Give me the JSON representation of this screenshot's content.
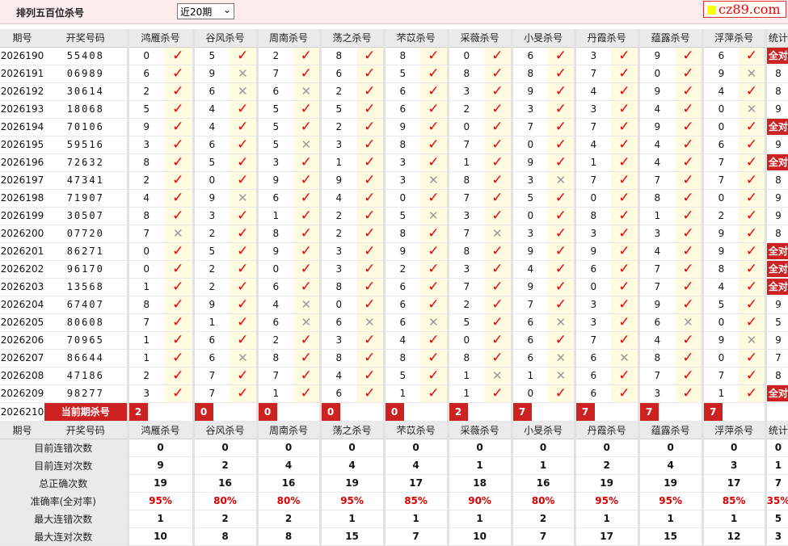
{
  "header": {
    "title": "排列五百位杀号",
    "select_value": "近20期",
    "logo_text": "cz89.com"
  },
  "columns": {
    "period": "期号",
    "numbers": "开奖号码",
    "stat": "统计",
    "groups": [
      "鸿雁杀号",
      "谷风杀号",
      "周南杀号",
      "荡之杀号",
      "芣苡杀号",
      "采薇杀号",
      "小旻杀号",
      "丹霞杀号",
      "蕴露杀号",
      "浮萍杀号"
    ]
  },
  "rows": [
    {
      "p": "2026190",
      "n": "55408",
      "v": [
        "0",
        "5",
        "2",
        "8",
        "8",
        "0",
        "6",
        "3",
        "9",
        "6"
      ],
      "r": [
        "y",
        "y",
        "y",
        "y",
        "y",
        "y",
        "y",
        "y",
        "y",
        "y"
      ],
      "s": "全对"
    },
    {
      "p": "2026191",
      "n": "06989",
      "v": [
        "6",
        "9",
        "7",
        "6",
        "5",
        "8",
        "8",
        "7",
        "0",
        "9"
      ],
      "r": [
        "y",
        "n",
        "y",
        "y",
        "y",
        "y",
        "y",
        "y",
        "y",
        "n"
      ],
      "s": "8"
    },
    {
      "p": "2026192",
      "n": "30614",
      "v": [
        "2",
        "6",
        "6",
        "2",
        "6",
        "3",
        "9",
        "4",
        "9",
        "4"
      ],
      "r": [
        "y",
        "n",
        "n",
        "y",
        "y",
        "y",
        "y",
        "y",
        "y",
        "y"
      ],
      "s": "8"
    },
    {
      "p": "2026193",
      "n": "18068",
      "v": [
        "5",
        "4",
        "5",
        "5",
        "6",
        "2",
        "3",
        "3",
        "4",
        "0"
      ],
      "r": [
        "y",
        "y",
        "y",
        "y",
        "y",
        "y",
        "y",
        "y",
        "y",
        "n"
      ],
      "s": "9"
    },
    {
      "p": "2026194",
      "n": "70106",
      "v": [
        "9",
        "4",
        "5",
        "2",
        "9",
        "0",
        "7",
        "7",
        "9",
        "0"
      ],
      "r": [
        "y",
        "y",
        "y",
        "y",
        "y",
        "y",
        "y",
        "y",
        "y",
        "y"
      ],
      "s": "全对"
    },
    {
      "p": "2026195",
      "n": "59516",
      "v": [
        "3",
        "6",
        "5",
        "3",
        "8",
        "7",
        "0",
        "4",
        "4",
        "6"
      ],
      "r": [
        "y",
        "y",
        "n",
        "y",
        "y",
        "y",
        "y",
        "y",
        "y",
        "y"
      ],
      "s": "9"
    },
    {
      "p": "2026196",
      "n": "72632",
      "v": [
        "8",
        "5",
        "3",
        "1",
        "3",
        "1",
        "9",
        "1",
        "4",
        "7"
      ],
      "r": [
        "y",
        "y",
        "y",
        "y",
        "y",
        "y",
        "y",
        "y",
        "y",
        "y"
      ],
      "s": "全对"
    },
    {
      "p": "2026197",
      "n": "47341",
      "v": [
        "2",
        "0",
        "9",
        "9",
        "3",
        "8",
        "3",
        "7",
        "7",
        "7"
      ],
      "r": [
        "y",
        "y",
        "y",
        "y",
        "n",
        "y",
        "n",
        "y",
        "y",
        "y"
      ],
      "s": "8"
    },
    {
      "p": "2026198",
      "n": "71907",
      "v": [
        "4",
        "9",
        "6",
        "4",
        "0",
        "7",
        "5",
        "0",
        "8",
        "0"
      ],
      "r": [
        "y",
        "n",
        "y",
        "y",
        "y",
        "y",
        "y",
        "y",
        "y",
        "y"
      ],
      "s": "9"
    },
    {
      "p": "2026199",
      "n": "30507",
      "v": [
        "8",
        "3",
        "1",
        "2",
        "5",
        "3",
        "0",
        "8",
        "1",
        "2"
      ],
      "r": [
        "y",
        "y",
        "y",
        "y",
        "n",
        "y",
        "y",
        "y",
        "y",
        "y"
      ],
      "s": "9"
    },
    {
      "p": "2026200",
      "n": "07720",
      "v": [
        "7",
        "2",
        "8",
        "2",
        "8",
        "7",
        "3",
        "3",
        "3",
        "9"
      ],
      "r": [
        "n",
        "y",
        "y",
        "y",
        "y",
        "n",
        "y",
        "y",
        "y",
        "y"
      ],
      "s": "8"
    },
    {
      "p": "2026201",
      "n": "86271",
      "v": [
        "0",
        "5",
        "9",
        "3",
        "9",
        "8",
        "9",
        "9",
        "4",
        "9"
      ],
      "r": [
        "y",
        "y",
        "y",
        "y",
        "y",
        "y",
        "y",
        "y",
        "y",
        "y"
      ],
      "s": "全对"
    },
    {
      "p": "2026202",
      "n": "96170",
      "v": [
        "0",
        "2",
        "0",
        "3",
        "2",
        "3",
        "4",
        "6",
        "7",
        "8"
      ],
      "r": [
        "y",
        "y",
        "y",
        "y",
        "y",
        "y",
        "y",
        "y",
        "y",
        "y"
      ],
      "s": "全对"
    },
    {
      "p": "2026203",
      "n": "13568",
      "v": [
        "1",
        "2",
        "6",
        "8",
        "6",
        "7",
        "9",
        "0",
        "7",
        "4"
      ],
      "r": [
        "y",
        "y",
        "y",
        "y",
        "y",
        "y",
        "y",
        "y",
        "y",
        "y"
      ],
      "s": "全对"
    },
    {
      "p": "2026204",
      "n": "67407",
      "v": [
        "8",
        "9",
        "4",
        "0",
        "6",
        "2",
        "7",
        "3",
        "9",
        "5"
      ],
      "r": [
        "y",
        "y",
        "n",
        "y",
        "y",
        "y",
        "y",
        "y",
        "y",
        "y"
      ],
      "s": "9"
    },
    {
      "p": "2026205",
      "n": "80608",
      "v": [
        "7",
        "1",
        "6",
        "6",
        "6",
        "5",
        "6",
        "3",
        "6",
        "0"
      ],
      "r": [
        "y",
        "y",
        "n",
        "n",
        "n",
        "y",
        "n",
        "y",
        "n",
        "y"
      ],
      "s": "5"
    },
    {
      "p": "2026206",
      "n": "70965",
      "v": [
        "1",
        "6",
        "2",
        "3",
        "4",
        "0",
        "6",
        "7",
        "4",
        "9"
      ],
      "r": [
        "y",
        "y",
        "y",
        "y",
        "y",
        "y",
        "y",
        "y",
        "y",
        "n"
      ],
      "s": "9"
    },
    {
      "p": "2026207",
      "n": "86644",
      "v": [
        "1",
        "6",
        "8",
        "8",
        "8",
        "8",
        "6",
        "6",
        "8",
        "0"
      ],
      "r": [
        "y",
        "n",
        "y",
        "y",
        "y",
        "y",
        "n",
        "n",
        "y",
        "y"
      ],
      "s": "7"
    },
    {
      "p": "2026208",
      "n": "47186",
      "v": [
        "2",
        "7",
        "7",
        "4",
        "5",
        "1",
        "1",
        "6",
        "7",
        "7"
      ],
      "r": [
        "y",
        "y",
        "y",
        "y",
        "y",
        "n",
        "n",
        "y",
        "y",
        "y"
      ],
      "s": "8"
    },
    {
      "p": "2026209",
      "n": "98277",
      "v": [
        "3",
        "7",
        "1",
        "6",
        "1",
        "1",
        "0",
        "6",
        "3",
        "1"
      ],
      "r": [
        "y",
        "y",
        "y",
        "y",
        "y",
        "y",
        "y",
        "y",
        "y",
        "y"
      ],
      "s": "全对"
    }
  ],
  "current": {
    "p": "2026210",
    "label": "当前期杀号",
    "v": [
      "2",
      "0",
      "0",
      "0",
      "0",
      "2",
      "7",
      "7",
      "7",
      "7"
    ]
  },
  "stats": [
    {
      "label": "目前连错次数",
      "v": [
        "0",
        "0",
        "0",
        "0",
        "0",
        "0",
        "0",
        "0",
        "0",
        "0"
      ],
      "s": "0"
    },
    {
      "label": "目前连对次数",
      "v": [
        "9",
        "2",
        "4",
        "4",
        "4",
        "1",
        "1",
        "2",
        "4",
        "3"
      ],
      "s": "1"
    },
    {
      "label": "总正确次数",
      "v": [
        "19",
        "16",
        "16",
        "19",
        "17",
        "18",
        "16",
        "19",
        "19",
        "17"
      ],
      "s": "7"
    },
    {
      "label": "准确率(全对率)",
      "v": [
        "95%",
        "80%",
        "80%",
        "95%",
        "85%",
        "90%",
        "80%",
        "95%",
        "95%",
        "85%"
      ],
      "s": "35%",
      "pct": true
    },
    {
      "label": "最大连错次数",
      "v": [
        "1",
        "2",
        "2",
        "1",
        "1",
        "1",
        "2",
        "1",
        "1",
        "1"
      ],
      "s": "5"
    },
    {
      "label": "最大连对次数",
      "v": [
        "10",
        "8",
        "8",
        "15",
        "7",
        "10",
        "7",
        "17",
        "15",
        "12"
      ],
      "s": "3"
    }
  ],
  "icons": {
    "right": "check-icon",
    "wrong": "cross-icon"
  },
  "colors": {
    "accent": "#cc2222",
    "blue": "#0a2fb5",
    "header_bg": "#fdecec"
  }
}
